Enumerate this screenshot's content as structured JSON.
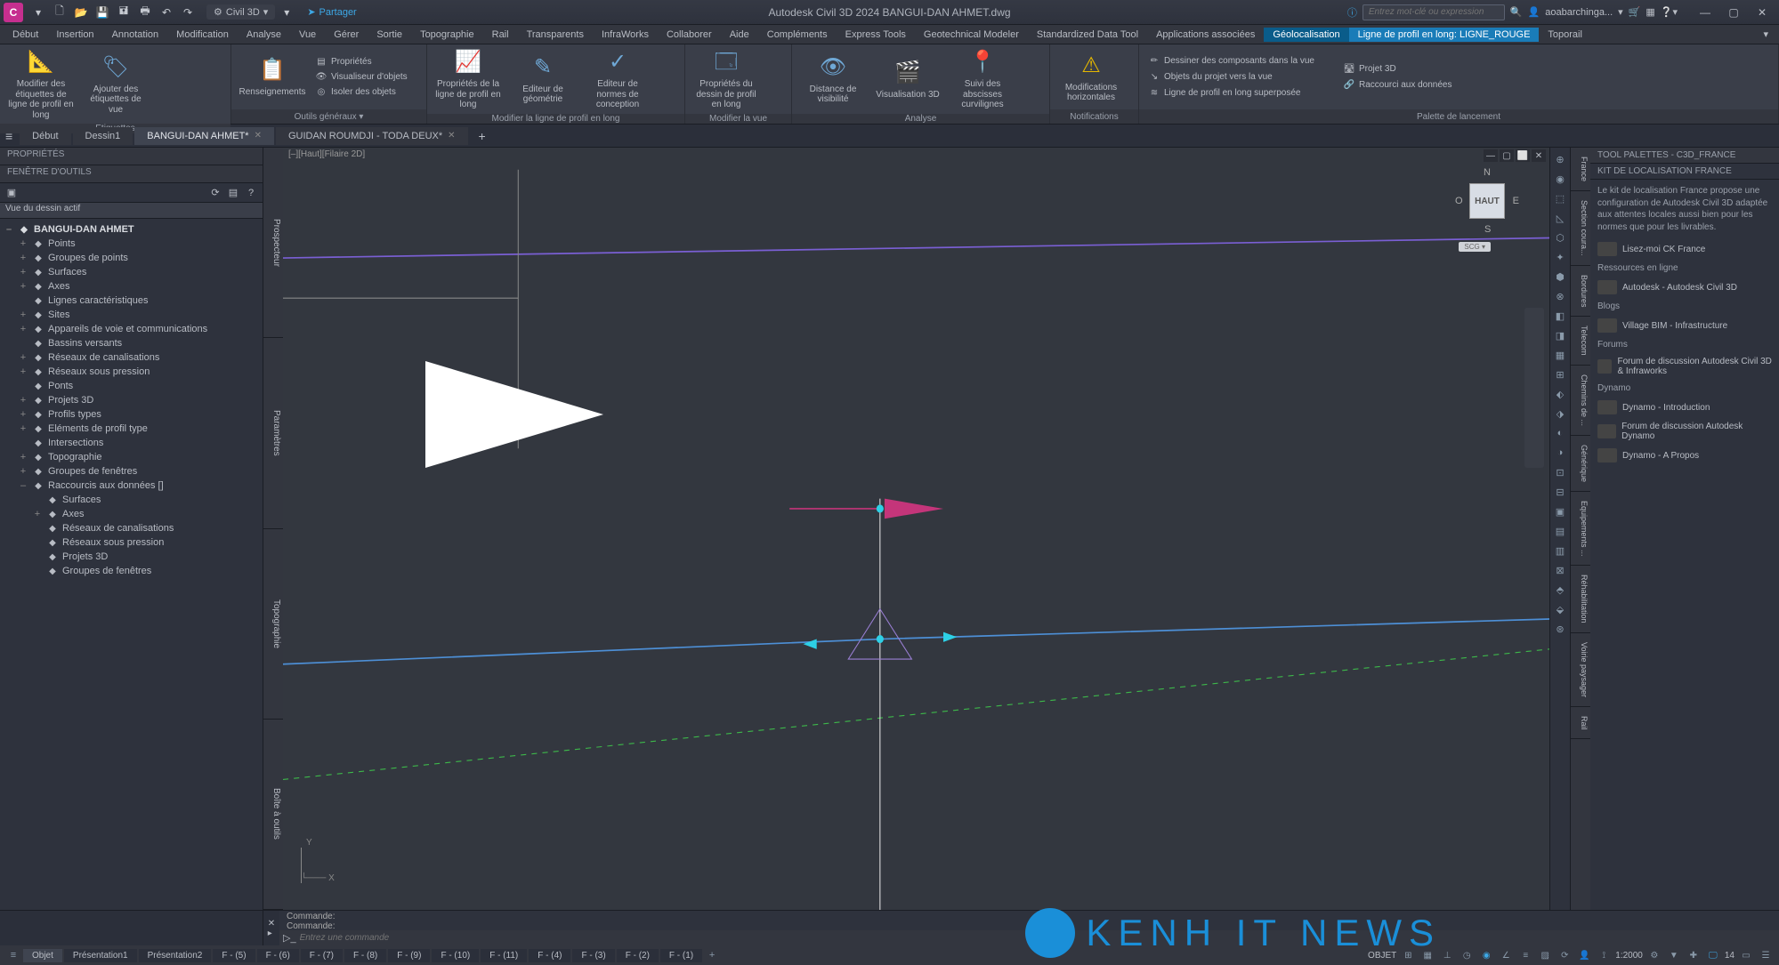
{
  "app": {
    "title_full": "Autodesk Civil 3D 2024    BANGUI-DAN AHMET.dwg",
    "workspace": "Civil 3D",
    "share": "Partager",
    "search_placeholder": "Entrez mot-clé ou expression",
    "user": "aoabarchinga..."
  },
  "menu": [
    "Début",
    "Insertion",
    "Annotation",
    "Modification",
    "Analyse",
    "Vue",
    "Gérer",
    "Sortie",
    "Topographie",
    "Rail",
    "Transparents",
    "InfraWorks",
    "Collaborer",
    "Aide",
    "Compléments",
    "Express Tools",
    "Geotechnical Modeler",
    "Standardized Data Tool",
    "Applications associées",
    "Géolocalisation",
    "Ligne de profil en long: LIGNE_ROUGE",
    "Toporail"
  ],
  "ribbon": {
    "panels": [
      {
        "title": "Etiquettes",
        "items": [
          {
            "label": "Modifier des étiquettes de ligne de profil en long"
          },
          {
            "label": "Ajouter des étiquettes de vue"
          }
        ]
      },
      {
        "title": "Outils généraux ▾",
        "items_large": [
          {
            "label": "Renseignements"
          }
        ],
        "items_small": [
          "Propriétés",
          "Visualiseur d'objets",
          "Isoler des objets"
        ]
      },
      {
        "title": "Modifier la ligne de profil en long",
        "items": [
          {
            "label": "Propriétés de la ligne de profil en long"
          },
          {
            "label": "Editeur de géométrie"
          },
          {
            "label": "Editeur de normes de conception"
          }
        ]
      },
      {
        "title": "Modifier la vue",
        "items": [
          {
            "label": "Propriétés du dessin de profil en long"
          }
        ]
      },
      {
        "title": "Analyse",
        "items": [
          {
            "label": "Distance de visibilité"
          },
          {
            "label": "Visualisation 3D"
          },
          {
            "label": "Suivi des abscisses curvilignes"
          }
        ]
      },
      {
        "title": "Notifications",
        "items": [
          {
            "label": "Modifications horizontales"
          }
        ]
      },
      {
        "title": "Palette de lancement",
        "items_small": [
          "Dessiner des composants dans la vue",
          "Objets du projet vers la vue",
          "Ligne de profil en long superposée",
          "Projet 3D",
          "Raccourci aux données"
        ]
      }
    ]
  },
  "doctabs": {
    "tabs": [
      {
        "label": "Début",
        "active": false
      },
      {
        "label": "Dessin1",
        "active": false
      },
      {
        "label": "BANGUI-DAN AHMET*",
        "active": true
      },
      {
        "label": "GUIDAN ROUMDJI - TODA DEUX*",
        "active": false
      }
    ]
  },
  "left": {
    "prop_title": "PROPRIÉTÉS",
    "tool_title": "FENÊTRE D'OUTILS",
    "view_dd": "Vue du dessin actif",
    "tree": [
      {
        "l": "BANGUI-DAN AHMET",
        "bold": true,
        "ind": 0,
        "exp": "–"
      },
      {
        "l": "Points",
        "ind": 1,
        "exp": "+"
      },
      {
        "l": "Groupes de points",
        "ind": 1,
        "exp": "+"
      },
      {
        "l": "Surfaces",
        "ind": 1,
        "exp": "+"
      },
      {
        "l": "Axes",
        "ind": 1,
        "exp": "+"
      },
      {
        "l": "Lignes caractéristiques",
        "ind": 1
      },
      {
        "l": "Sites",
        "ind": 1,
        "exp": "+"
      },
      {
        "l": "Appareils de voie et communications",
        "ind": 1,
        "exp": "+"
      },
      {
        "l": "Bassins versants",
        "ind": 1
      },
      {
        "l": "Réseaux de canalisations",
        "ind": 1,
        "exp": "+"
      },
      {
        "l": "Réseaux sous pression",
        "ind": 1,
        "exp": "+"
      },
      {
        "l": "Ponts",
        "ind": 1
      },
      {
        "l": "Projets 3D",
        "ind": 1,
        "exp": "+"
      },
      {
        "l": "Profils types",
        "ind": 1,
        "exp": "+"
      },
      {
        "l": "Eléments de profil type",
        "ind": 1,
        "exp": "+"
      },
      {
        "l": "Intersections",
        "ind": 1
      },
      {
        "l": "Topographie",
        "ind": 1,
        "exp": "+"
      },
      {
        "l": "Groupes de fenêtres",
        "ind": 1,
        "exp": "+"
      },
      {
        "l": "Raccourcis aux données []",
        "ind": 1,
        "exp": "–"
      },
      {
        "l": "Surfaces",
        "ind": 2
      },
      {
        "l": "Axes",
        "ind": 2,
        "exp": "+"
      },
      {
        "l": "Réseaux de canalisations",
        "ind": 2
      },
      {
        "l": "Réseaux sous pression",
        "ind": 2
      },
      {
        "l": "Projets 3D",
        "ind": 2
      },
      {
        "l": "Groupes de fenêtres",
        "ind": 2
      }
    ],
    "side_tabs": [
      "Prospecteur",
      "Paramètres",
      "Topographie",
      "Boîte à outils"
    ]
  },
  "canvas": {
    "header": "[–][Haut][Filaire 2D]",
    "viewcube": {
      "face": "HAUT",
      "n": "N",
      "s": "S",
      "e": "E",
      "o": "O",
      "scu": "SCG ▾"
    }
  },
  "right": {
    "title": "TOOL PALETTES - C3D_FRANCE",
    "kit_title": "KIT DE LOCALISATION FRANCE",
    "kit_desc": "Le kit de localisation France propose une configuration de Autodesk Civil 3D adaptée aux attentes locales aussi bien pour les normes que pour les livrables.",
    "items": [
      {
        "heading": "",
        "link": "Lisez-moi CK France"
      },
      {
        "heading": "Ressources en ligne"
      },
      {
        "link": "Autodesk - Autodesk Civil 3D"
      },
      {
        "heading": "Blogs"
      },
      {
        "link": "Village BIM - Infrastructure"
      },
      {
        "heading": "Forums"
      },
      {
        "link": "Forum de discussion Autodesk Civil 3D & Infraworks"
      },
      {
        "heading": "Dynamo"
      },
      {
        "link": "Dynamo - Introduction"
      },
      {
        "link": "Forum de discussion Autodesk Dynamo"
      },
      {
        "link": "Dynamo - A Propos"
      }
    ],
    "pal_tabs": [
      "France",
      "Section coura...",
      "Bordures",
      "Telecom",
      "Chemins de ...",
      "Générique",
      "Equipements ...",
      "Réhabilitation",
      "Voirie paysager",
      "Rail"
    ]
  },
  "cmd": {
    "hist1": "Commande:",
    "hist2": "Commande:",
    "placeholder": "Entrez une commande"
  },
  "status": {
    "layout_tabs": [
      "Objet",
      "Présentation1",
      "Présentation2",
      "F - (5)",
      "F - (6)",
      "F - (7)",
      "F - (8)",
      "F - (9)",
      "F - (10)",
      "F - (11)",
      "F - (4)",
      "F - (3)",
      "F - (2)",
      "F - (1)"
    ],
    "objet": "OBJET",
    "scale": "1:2000",
    "count": "14"
  },
  "watermark": "KENH IT NEWS"
}
